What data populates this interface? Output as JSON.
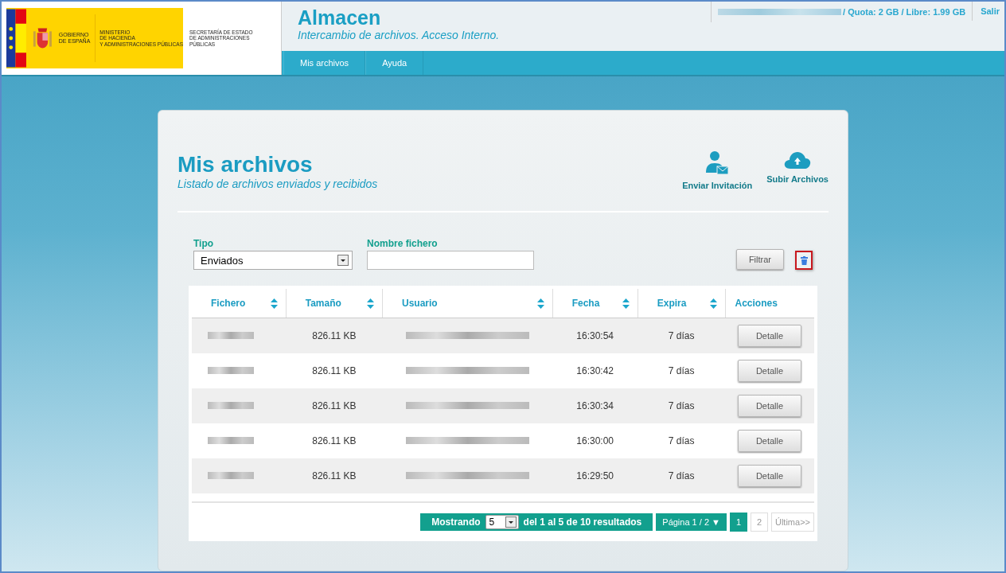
{
  "header": {
    "logo": {
      "gov_line1": "GOBIERNO",
      "gov_line2": "DE ESPAÑA",
      "ministry": [
        "MINISTERIO",
        "DE HACIENDA",
        "Y ADMINISTRACIONES PÚBLICAS"
      ],
      "secretariat": [
        "SECRETARÍA DE ESTADO",
        "DE ADMINISTRACIONES  PÚBLICAS"
      ]
    },
    "app_title": "Almacen",
    "app_subtitle": "Intercambio de archivos. Acceso Interno.",
    "quota": "/ Quota: 2 GB / Libre: 1.99 GB",
    "logout": "Salir",
    "nav": [
      {
        "label": "Mis archivos"
      },
      {
        "label": "Ayuda"
      }
    ]
  },
  "page": {
    "title": "Mis archivos",
    "subtitle": "Listado de archivos enviados y recibidos",
    "actions": [
      {
        "label": "Enviar Invitación",
        "kind": "invite"
      },
      {
        "label": "Subir Archivos",
        "kind": "upload"
      }
    ]
  },
  "filters": {
    "type_label": "Tipo",
    "type_value": "Enviados",
    "name_label": "Nombre fichero",
    "filter_button": "Filtrar"
  },
  "table": {
    "columns": [
      {
        "label": "Fichero",
        "sortable": true
      },
      {
        "label": "Tamaño",
        "sortable": true
      },
      {
        "label": "Usuario",
        "sortable": true
      },
      {
        "label": "Fecha",
        "sortable": true
      },
      {
        "label": "Expira",
        "sortable": true
      },
      {
        "label": "Acciones",
        "sortable": false
      }
    ],
    "rows": [
      {
        "size": "826.11 KB",
        "date": "16:30:54",
        "expires": "7 días",
        "action": "Detalle"
      },
      {
        "size": "826.11 KB",
        "date": "16:30:42",
        "expires": "7 días",
        "action": "Detalle"
      },
      {
        "size": "826.11 KB",
        "date": "16:30:34",
        "expires": "7 días",
        "action": "Detalle"
      },
      {
        "size": "826.11 KB",
        "date": "16:30:00",
        "expires": "7 días",
        "action": "Detalle"
      },
      {
        "size": "826.11 KB",
        "date": "16:29:50",
        "expires": "7 días",
        "action": "Detalle"
      }
    ]
  },
  "pagination": {
    "showing_label": "Mostrando",
    "page_size": "5",
    "range": "del 1 al 5 de 10 resultados",
    "page_menu": "Página 1 / 2",
    "arrow": "▼",
    "pages": [
      {
        "label": "1",
        "selected": true
      },
      {
        "label": "2",
        "selected": false
      }
    ],
    "last": "Última>>"
  }
}
